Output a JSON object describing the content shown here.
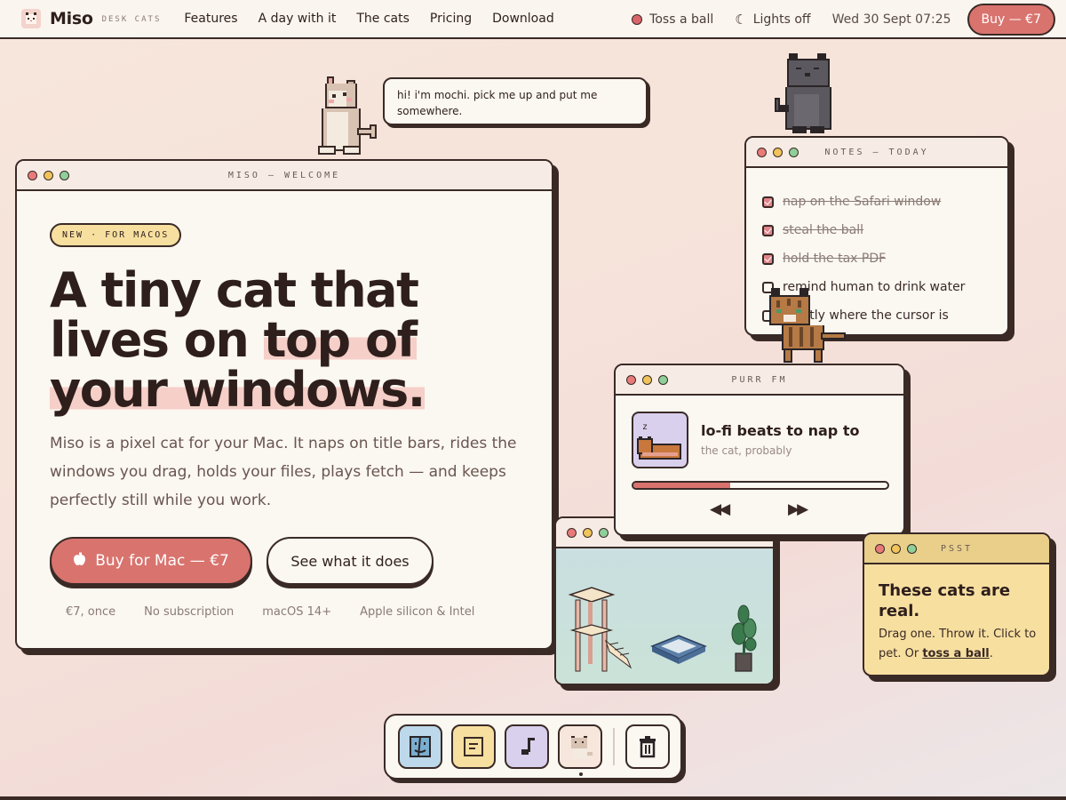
{
  "brand": {
    "name": "Miso",
    "tagline": "DESK CATS"
  },
  "nav": [
    "Features",
    "A day with it",
    "The cats",
    "Pricing",
    "Download"
  ],
  "topbar": {
    "toss_label": "Toss a ball",
    "lights_label": "Lights off",
    "clock": "Wed 30 Sept 07:25",
    "buy_label": "Buy — €7"
  },
  "speech_bubble": "hi! i'm mochi. pick me up and put me somewhere.",
  "main_window": {
    "title": "MISO — WELCOME",
    "badge": "NEW · FOR MACOS",
    "headline_1": "A tiny cat that",
    "headline_2a": "lives on ",
    "headline_2b": "top of",
    "headline_3": "your windows.",
    "lede": "Miso is a pixel cat for your Mac. It naps on title bars, rides the windows you drag, holds your files, plays fetch — and keeps perfectly still while you work.",
    "buy_button": "Buy for Mac — €7",
    "see_button": "See what it does",
    "facts": [
      "€7, once",
      "No subscription",
      "macOS 14+",
      "Apple silicon & Intel"
    ]
  },
  "notes_window": {
    "title": "NOTES — TODAY",
    "items": [
      {
        "text": "nap on the Safari window",
        "done": true
      },
      {
        "text": "steal the ball",
        "done": true
      },
      {
        "text": "hold the tax PDF",
        "done": true
      },
      {
        "text": "remind human to drink water",
        "done": false
      },
      {
        "text": "actly where the cursor is",
        "done": false
      }
    ]
  },
  "purr_window": {
    "title": "PURR FM",
    "track_title": "lo-fi beats to nap to",
    "track_artist": "the cat, probably",
    "progress": 0.38,
    "prev_icon": "rewind-icon",
    "next_icon": "fast-forward-icon"
  },
  "psst_window": {
    "title": "PSST",
    "headline": "These cats are real.",
    "body_prefix": "Drag one. Throw it. Click to pet. Or ",
    "link": "toss a ball",
    "body_suffix": "."
  },
  "dock": {
    "items": [
      "finder-icon",
      "notes-icon",
      "music-icon",
      "miso-cat-icon",
      "trash-icon"
    ]
  },
  "colors": {
    "accent": "#d9736e",
    "ink": "#3a2a26",
    "paper": "#fbf7f1",
    "yellow": "#f7dfa0"
  }
}
